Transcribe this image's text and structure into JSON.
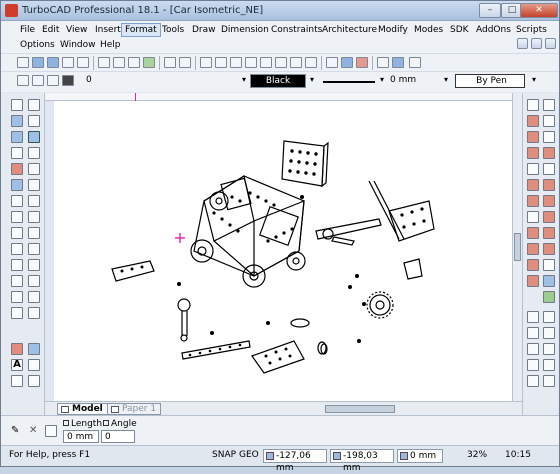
{
  "window": {
    "title": "TurboCAD Professional 18.1 - [Car Isometric_NE]",
    "controls": {
      "minimize": "–",
      "maximize": "□",
      "close": "✕"
    }
  },
  "menus": {
    "row1": [
      "File",
      "Edit",
      "View",
      "Insert",
      "Format",
      "Tools",
      "Draw",
      "Dimension",
      "Constraints",
      "Architecture",
      "Modify",
      "Modes",
      "SDK",
      "AddOns",
      "Scripts"
    ],
    "row2": [
      "Options",
      "Window",
      "Help"
    ],
    "active": "Format"
  },
  "property_bar": {
    "layer_value": "0",
    "color_label": "Black",
    "line_width": "0 mm",
    "pen_style": "By Pen"
  },
  "tabs": [
    {
      "label": "Model",
      "active": true
    },
    {
      "label": "Paper 1",
      "active": false
    }
  ],
  "inspector": {
    "length_label": "Length",
    "angle_label": "Angle",
    "length_value": "0 mm",
    "angle_value": "0"
  },
  "status": {
    "help": "For Help, press F1",
    "snap": "SNAP",
    "geo": "GEO",
    "x": "-127,06 mm",
    "y": "-198,03 mm",
    "z": "0 mm",
    "zoom": "32%",
    "time": "10:15"
  },
  "colors": {
    "accent": "#7fa0cb",
    "cursor": "#e020b0",
    "canvas": "#ffffff"
  }
}
